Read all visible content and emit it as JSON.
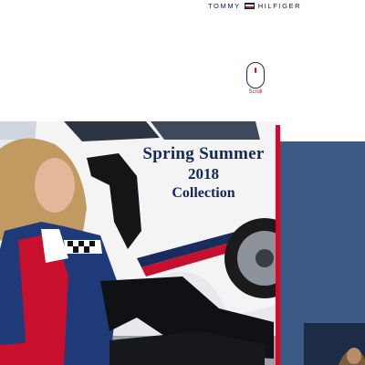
{
  "header": {
    "brand_left": "TOMMY",
    "brand_right": "HILFIGER",
    "flag_colors": [
      "#14275a",
      "#ffffff",
      "#c8102e"
    ]
  },
  "scroll": {
    "label": "Scroll",
    "icon": "mouse-icon"
  },
  "hero": {
    "title_line1": "Spring Summer",
    "title_line2": "2018",
    "title_line3": "Collection"
  },
  "colors": {
    "navy": "#14275a",
    "red": "#c8102e",
    "panel_blue": "#3b5a86"
  }
}
